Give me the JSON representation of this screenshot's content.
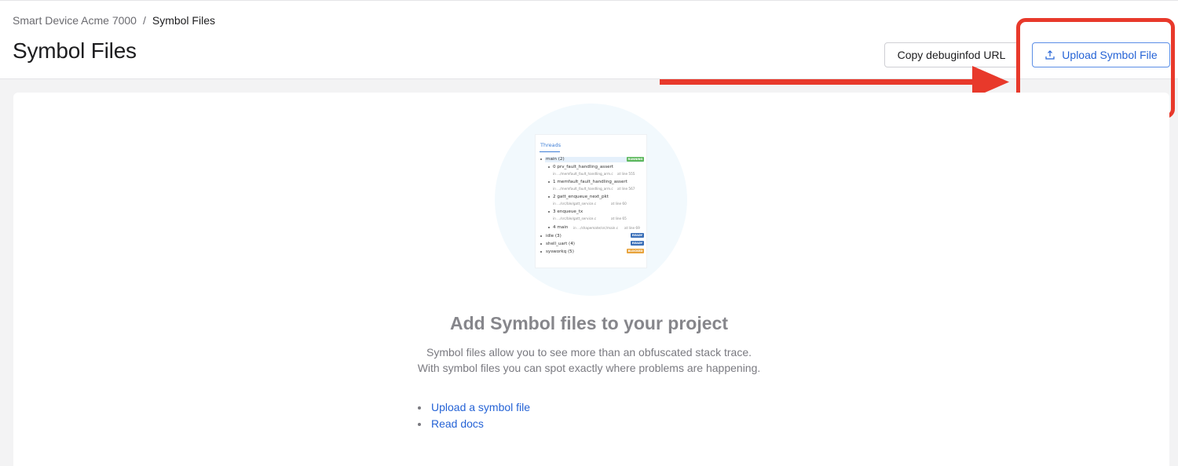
{
  "breadcrumb": {
    "project": "Smart Device Acme 7000",
    "separator": "/",
    "current": "Symbol Files"
  },
  "page": {
    "title": "Symbol Files"
  },
  "toolbar": {
    "copy_label": "Copy debuginfod URL",
    "upload_label": "Upload Symbol File"
  },
  "illustration": {
    "tab": "Threads",
    "threads": [
      {
        "label": "main (2)",
        "status": "RUNNING"
      },
      {
        "label": "idle (3)",
        "status": "READY"
      },
      {
        "label": "shell_uart (4)",
        "status": "READY"
      },
      {
        "label": "sysworkq (5)",
        "status": "BLOCKED"
      }
    ],
    "frames": [
      {
        "label": "0 prv_fault_handling_assert",
        "path": "in .../memfault_fault_handling_arm.c",
        "line": "at line 555"
      },
      {
        "label": "1 memfault_fault_handling_assert",
        "path": "in .../memfault_fault_handling_arm.c",
        "line": "at line 567"
      },
      {
        "label": "2 gatt_enqueue_next_pkt",
        "path": "in .../src/ble/gatt_service.c",
        "line": "at line 60"
      },
      {
        "label": "3 enqueue_tx",
        "path": "in .../src/ble/gatt_service.c",
        "line": "at line 65"
      },
      {
        "label": "4 main",
        "path": "in .../shapemate/src/main.c",
        "line": "at line 69"
      }
    ]
  },
  "empty_state": {
    "title": "Add Symbol files to your project",
    "desc_line1": "Symbol files allow you to see more than an obfuscated stack trace.",
    "desc_line2": "With symbol files you can spot exactly where problems are happening.",
    "link_upload": "Upload a symbol file",
    "link_docs": "Read docs"
  },
  "colors": {
    "accent": "#2563d6",
    "annotation": "#e8392b",
    "running": "#5cb85c",
    "ready": "#3a6fb8",
    "blocked": "#e8a33c"
  },
  "icons": {
    "upload": "upload-icon",
    "copy_frame": "copy-icon"
  }
}
